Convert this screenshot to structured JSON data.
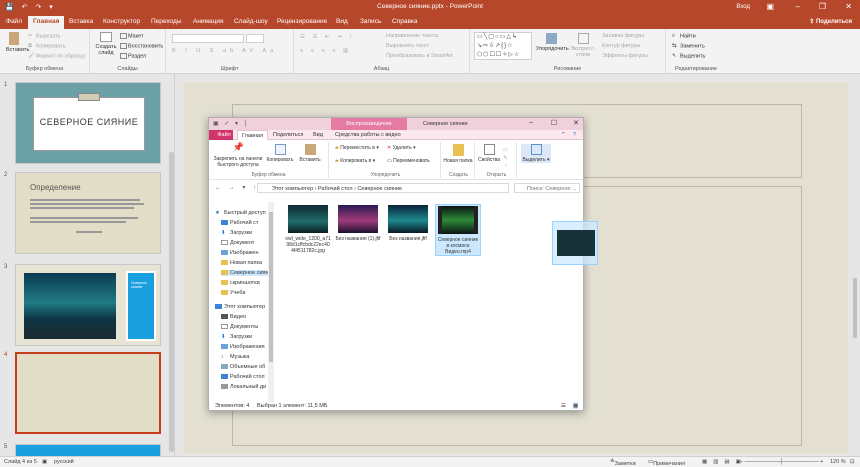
{
  "app": {
    "title": "Северное сияние.pptx - PowerPoint",
    "user": "Вход"
  },
  "menu": {
    "tabs": [
      "Файл",
      "Главная",
      "Вставка",
      "Конструктор",
      "Переходы",
      "Анимация",
      "Слайд-шоу",
      "Рецензирование",
      "Вид",
      "Запись",
      "Справка"
    ],
    "share": "Поделиться"
  },
  "ribbon": {
    "clipboard": {
      "label": "Буфер обмена",
      "paste": "Вставить",
      "cut": "Вырезать",
      "copy": "Копировать",
      "format": "Формат по образцу"
    },
    "slides": {
      "label": "Слайды",
      "new": "Создать слайд",
      "layout": "Макет",
      "reset": "Восстановить",
      "section": "Раздел"
    },
    "font": {
      "label": "Шрифт"
    },
    "paragraph": {
      "label": "Абзац",
      "dir": "Направление текста",
      "align": "Выровнять текст",
      "smartart": "Преобразовать в SmartArt"
    },
    "drawing": {
      "label": "Рисование",
      "arrange": "Упорядочить",
      "styles": "Экспресс-стили",
      "fill": "Заливка фигуры",
      "outline": "Контур фигуры",
      "effects": "Эффекты фигуры"
    },
    "editing": {
      "label": "Редактирование",
      "find": "Найти",
      "replace": "Заменить",
      "select": "Выделить"
    }
  },
  "slides": [
    {
      "num": "1",
      "title": "СЕВЕРНОЕ СИЯНИЕ"
    },
    {
      "num": "2",
      "title": "Определение"
    },
    {
      "num": "3",
      "caption": "Северное сияние"
    },
    {
      "num": "4"
    },
    {
      "num": "5"
    }
  ],
  "statusbar": {
    "slide": "Слайд 4 из 5",
    "lang": "русский",
    "notes": "Заметки",
    "comments": "Примечания",
    "zoom": "120 %"
  },
  "explorer": {
    "context_tab": "Воспроизведение",
    "title": "Северное сияние",
    "tabs": [
      "Файл",
      "Главная",
      "Поделиться",
      "Вид",
      "Средства работы с видео"
    ],
    "ribbon": {
      "pin": "Закрепить на панели быстрого доступа",
      "copy": "Копировать",
      "paste": "Вставить",
      "clipboard_label": "Буфер обмена",
      "move": "Переместить в",
      "copy_to": "Копировать в",
      "delete": "Удалить",
      "rename": "Переименовать",
      "organize_label": "Упорядочить",
      "new_folder": "Новая папка",
      "create_label": "Создать",
      "properties": "Свойства",
      "open_label": "Открыть",
      "select": "Выделить"
    },
    "path": [
      "Этот компьютер",
      "Рабочий стол",
      "Северное сияние"
    ],
    "search_placeholder": "Поиск: Северное ...",
    "nav": [
      "Быстрый доступ",
      "Рабочий ст",
      "Загрузки",
      "Документ",
      "Изображен",
      "Новая папка",
      "Северное сиян",
      "скриншотки",
      "Учеба",
      "Этот компьютер",
      "Видео",
      "Документы",
      "Загрузки",
      "Изображения",
      "Музыка",
      "Объемные об",
      "Рабочий стол",
      "Локальный ди"
    ],
    "files": [
      {
        "name": "owl_wide_1200_a7198d1cffcbdc22ec404f4511782c.jpg"
      },
      {
        "name": "Без названия (1).jfif"
      },
      {
        "name": "Без названия.jfif"
      },
      {
        "name": "Северное сияние в космосе Видео.mp4"
      }
    ],
    "status": {
      "count": "Элементов: 4",
      "selected": "Выбран 1 элемент: 11,5 МБ"
    }
  }
}
